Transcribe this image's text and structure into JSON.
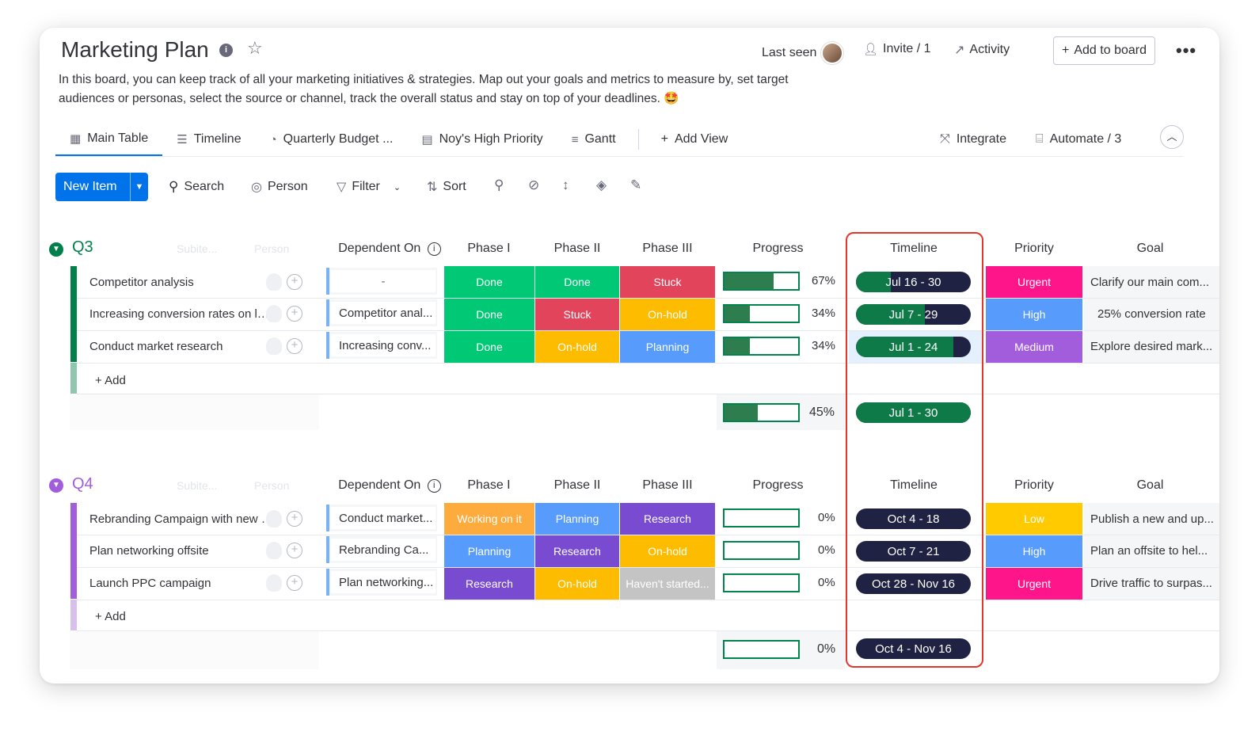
{
  "board": {
    "title": "Marketing Plan",
    "description": "In this board, you can keep track of all your marketing initiatives & strategies. Map out your goals and metrics to measure by, set target audiences or personas, select the source or channel, track the overall status and stay on top of your deadlines. 🤩"
  },
  "header": {
    "last_seen": "Last seen",
    "invite": "Invite / 1",
    "activity": "Activity",
    "add_to_board": "Add to board"
  },
  "tabs": [
    {
      "label": "Main Table",
      "icon": "table-home-icon",
      "active": true
    },
    {
      "label": "Timeline",
      "icon": "timeline-icon"
    },
    {
      "label": "Quarterly Budget ...",
      "icon": "pie-chart-icon"
    },
    {
      "label": "Noy's High Priority",
      "icon": "table-icon"
    },
    {
      "label": "Gantt",
      "icon": "gantt-icon"
    },
    {
      "label": "Add View",
      "icon": "plus-icon"
    }
  ],
  "tab_right": {
    "integrate": "Integrate",
    "automate": "Automate / 3"
  },
  "toolbar": {
    "new_item": "New Item",
    "search": "Search",
    "person": "Person",
    "filter": "Filter",
    "sort": "Sort"
  },
  "columns": {
    "subitems": "Subite...",
    "person": "Person",
    "dependent_on": "Dependent On",
    "phase1": "Phase I",
    "phase2": "Phase II",
    "phase3": "Phase III",
    "progress": "Progress",
    "timeline": "Timeline",
    "priority": "Priority",
    "goal": "Goal"
  },
  "colors": {
    "done": "#00c875",
    "stuck": "#e2445c",
    "onhold": "#fdbc00",
    "planning": "#579bfc",
    "working": "#fdab3d",
    "research": "#784bd1",
    "not_started": "#c4c4c4",
    "urgent": "#ff158a",
    "high": "#579bfc",
    "medium": "#a25ddc",
    "low": "#ffcb00",
    "q3": "#037f4c",
    "q4": "#a25ddc"
  },
  "groups": [
    {
      "name": "Q3",
      "add_label": "+ Add",
      "rows": [
        {
          "name": "Competitor analysis",
          "dep": "-",
          "p1": "Done",
          "p2": "Done",
          "p3": "Stuck",
          "progress": "67%",
          "progress_value": 0.67,
          "timeline": "Jul 16 - 30",
          "timeline_elapsed": 0.3,
          "priority": "Urgent",
          "goal": "Clarify our main com..."
        },
        {
          "name": "Increasing conversion rates on lan...",
          "dep": "Competitor anal...",
          "p1": "Done",
          "p2": "Stuck",
          "p3": "On-hold",
          "progress": "34%",
          "progress_value": 0.34,
          "timeline": "Jul 7 - 29",
          "timeline_elapsed": 0.6,
          "priority": "High",
          "goal": "25% conversion rate"
        },
        {
          "name": "Conduct market research",
          "dep": "Increasing conv...",
          "p1": "Done",
          "p2": "On-hold",
          "p3": "Planning",
          "progress": "34%",
          "progress_value": 0.34,
          "timeline": "Jul 1 - 24",
          "timeline_elapsed": 0.85,
          "priority": "Medium",
          "goal": "Explore desired mark..."
        }
      ],
      "summary": {
        "progress": "45%",
        "progress_value": 0.45,
        "timeline": "Jul 1 - 30",
        "timeline_elapsed": 1.0
      }
    },
    {
      "name": "Q4",
      "add_label": "+ Add",
      "rows": [
        {
          "name": "Rebranding Campaign with new lo...",
          "dep": "Conduct market...",
          "p1": "Working on it",
          "p2": "Planning",
          "p3": "Research",
          "progress": "0%",
          "progress_value": 0,
          "timeline": "Oct 4 - 18",
          "timeline_elapsed": 0,
          "priority": "Low",
          "goal": "Publish a new and up..."
        },
        {
          "name": "Plan networking offsite",
          "dep": "Rebranding Ca...",
          "p1": "Planning",
          "p2": "Research",
          "p3": "On-hold",
          "progress": "0%",
          "progress_value": 0,
          "timeline": "Oct 7 - 21",
          "timeline_elapsed": 0,
          "priority": "High",
          "goal": "Plan an offsite to hel..."
        },
        {
          "name": "Launch PPC campaign",
          "dep": "Plan networking...",
          "p1": "Research",
          "p2": "On-hold",
          "p3": "Haven't started...",
          "progress": "0%",
          "progress_value": 0,
          "timeline": "Oct 28 - Nov 16",
          "timeline_elapsed": 0,
          "priority": "Urgent",
          "goal": "Drive traffic to surpas..."
        }
      ],
      "summary": {
        "progress": "0%",
        "progress_value": 0,
        "timeline": "Oct 4 - Nov 16",
        "timeline_elapsed": 0
      }
    }
  ]
}
